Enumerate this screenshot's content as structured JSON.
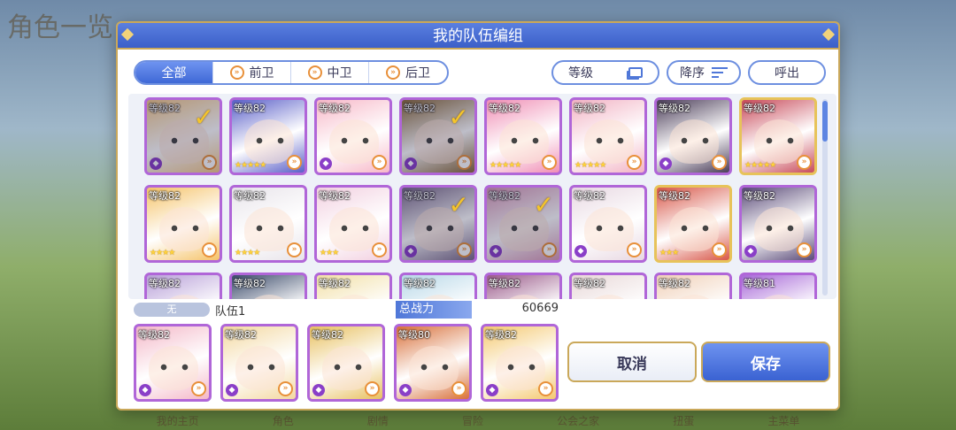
{
  "background": {
    "title": "角色一览",
    "bottom_nav": [
      "我的主页",
      "角色",
      "剧情",
      "冒险",
      "公会之家",
      "扭蛋",
      "主菜单"
    ]
  },
  "dialog": {
    "title": "我的队伍编组"
  },
  "filters": {
    "tabs": [
      {
        "label": "全部",
        "active": true
      },
      {
        "label": "前卫",
        "icon": "vanguard-icon"
      },
      {
        "label": "中卫",
        "icon": "midguard-icon"
      },
      {
        "label": "后卫",
        "icon": "rearguard-icon"
      }
    ],
    "sort_key": "等级",
    "order": "降序",
    "recall": "呼出"
  },
  "roster": [
    {
      "level": "等级82",
      "selected": true,
      "stars": 0,
      "unique": true
    },
    {
      "level": "等级82",
      "selected": false,
      "stars": 5,
      "unique": false
    },
    {
      "level": "等级82",
      "selected": false,
      "stars": 0,
      "unique": true
    },
    {
      "level": "等级82",
      "selected": true,
      "stars": 0,
      "unique": true
    },
    {
      "level": "等级82",
      "selected": false,
      "stars": 5,
      "unique": false
    },
    {
      "level": "等级82",
      "selected": false,
      "stars": 5,
      "unique": false
    },
    {
      "level": "等级82",
      "selected": false,
      "stars": 0,
      "unique": true
    },
    {
      "level": "等级82",
      "selected": false,
      "stars": 5,
      "unique": false,
      "gold": true
    },
    {
      "level": "等级82",
      "selected": false,
      "stars": 4,
      "unique": false
    },
    {
      "level": "等级82",
      "selected": false,
      "stars": 4,
      "unique": false
    },
    {
      "level": "等级82",
      "selected": false,
      "stars": 3,
      "unique": false
    },
    {
      "level": "等级82",
      "selected": true,
      "stars": 0,
      "unique": true
    },
    {
      "level": "等级82",
      "selected": true,
      "stars": 0,
      "unique": true
    },
    {
      "level": "等级82",
      "selected": false,
      "stars": 0,
      "unique": true
    },
    {
      "level": "等级82",
      "selected": false,
      "stars": 3,
      "unique": false,
      "gold": true
    },
    {
      "level": "等级82",
      "selected": false,
      "stars": 0,
      "unique": true
    },
    {
      "level": "等级82",
      "selected": false,
      "stars": 0,
      "unique": false
    },
    {
      "level": "等级82",
      "selected": false,
      "stars": 0,
      "unique": false
    },
    {
      "level": "等级82",
      "selected": false,
      "stars": 0,
      "unique": false
    },
    {
      "level": "等级82",
      "selected": false,
      "stars": 0,
      "unique": false
    },
    {
      "level": "等级82",
      "selected": false,
      "stars": 0,
      "unique": false
    },
    {
      "level": "等级82",
      "selected": false,
      "stars": 0,
      "unique": false
    },
    {
      "level": "等级82",
      "selected": false,
      "stars": 0,
      "unique": false
    },
    {
      "level": "等级81",
      "selected": false,
      "stars": 0,
      "unique": false
    }
  ],
  "team": {
    "badge": "无",
    "name": "队伍1",
    "power_label": "总战力",
    "power_value": "60669",
    "members": [
      {
        "level": "等级82"
      },
      {
        "level": "等级82"
      },
      {
        "level": "等级82"
      },
      {
        "level": "等级80"
      },
      {
        "level": "等级82"
      }
    ]
  },
  "buttons": {
    "cancel": "取消",
    "save": "保存"
  },
  "palette": [
    "#f3c98a",
    "#5a5fc8",
    "#f7b8c8",
    "#8a6a3a",
    "#f08fb5",
    "#f2b3c4",
    "#4a3c58",
    "#c84a5a",
    "#f5c36a",
    "#e8e4ea",
    "#f2d0e0",
    "#7a6a8a",
    "#d89ab8",
    "#e8d8e2",
    "#d8584a",
    "#5a4a78",
    "#b8a0d8",
    "#3a4a6a",
    "#f2e0a8",
    "#b8d8e8",
    "#9a5a8a",
    "#e8d8d8",
    "#f0d0b8",
    "#a86ad8"
  ],
  "team_palette": [
    "#f4b8c8",
    "#f3d8a0",
    "#e8c060",
    "#d8703a",
    "#f4c870"
  ]
}
